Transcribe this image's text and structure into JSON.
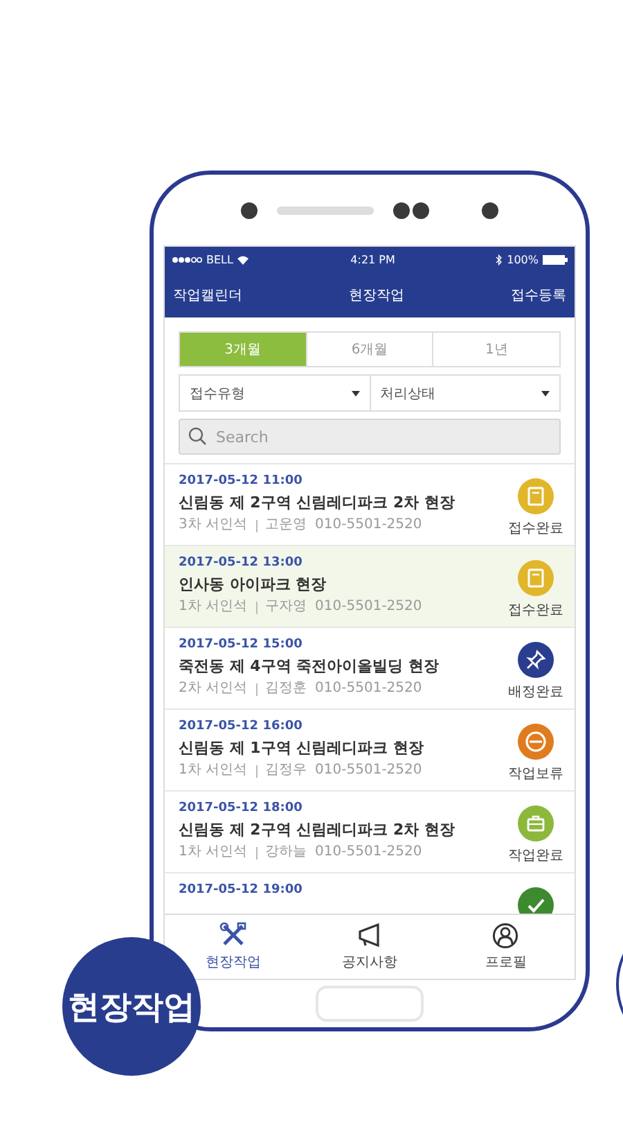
{
  "status_bar": {
    "carrier": "BELL",
    "time": "4:21 PM",
    "battery": "100%"
  },
  "nav_bar": {
    "left": "작업캘린더",
    "title": "현장작업",
    "right": "접수등록"
  },
  "period_tabs": [
    {
      "label": "3개월",
      "selected": true
    },
    {
      "label": "6개월",
      "selected": false
    },
    {
      "label": "1년",
      "selected": false
    }
  ],
  "filters": [
    {
      "label": "접수유형"
    },
    {
      "label": "처리상태"
    }
  ],
  "search": {
    "placeholder": "Search"
  },
  "jobs": [
    {
      "datetime": "2017-05-12 11:00",
      "title": "신림동 제 2구역 신림레디파크 2차 현장",
      "stage": "3차 서인석",
      "worker": "고운영",
      "phone": "010-5501-2520",
      "status": "접수완료",
      "kind": "clipboard",
      "color": "#e2b62b",
      "selected": false
    },
    {
      "datetime": "2017-05-12 13:00",
      "title": "인사동 아이파크 현장",
      "stage": "1차 서인석",
      "worker": "구자영",
      "phone": "010-5501-2520",
      "status": "접수완료",
      "kind": "clipboard",
      "color": "#e2b62b",
      "selected": true
    },
    {
      "datetime": "2017-05-12 15:00",
      "title": "죽전동 제 4구역 죽전아이올빌딩 현장",
      "stage": "2차 서인석",
      "worker": "김정훈",
      "phone": "010-5501-2520",
      "status": "배정완료",
      "kind": "pin",
      "color": "#2b3d8f",
      "selected": false
    },
    {
      "datetime": "2017-05-12 16:00",
      "title": "신림동 제 1구역 신림레디파크 현장",
      "stage": "1차 서인석",
      "worker": "김정우",
      "phone": "010-5501-2520",
      "status": "작업보류",
      "kind": "minus",
      "color": "#e07c1f",
      "selected": false
    },
    {
      "datetime": "2017-05-12 18:00",
      "title": "신림동 제 2구역 신림레디파크 2차 현장",
      "stage": "1차 서인석",
      "worker": "강하늘",
      "phone": "010-5501-2520",
      "status": "작업완료",
      "kind": "briefcase",
      "color": "#8cb83c",
      "selected": false
    },
    {
      "datetime": "2017-05-12 19:00",
      "kind": "check",
      "color": "#3e8a2f",
      "selected": false
    }
  ],
  "tab_bar": [
    {
      "label": "현장작업",
      "kind": "tools",
      "selected": true
    },
    {
      "label": "공지사항",
      "kind": "megaphone",
      "selected": false
    },
    {
      "label": "프로필",
      "kind": "profile",
      "selected": false
    }
  ],
  "badge": {
    "label": "현장작업"
  }
}
